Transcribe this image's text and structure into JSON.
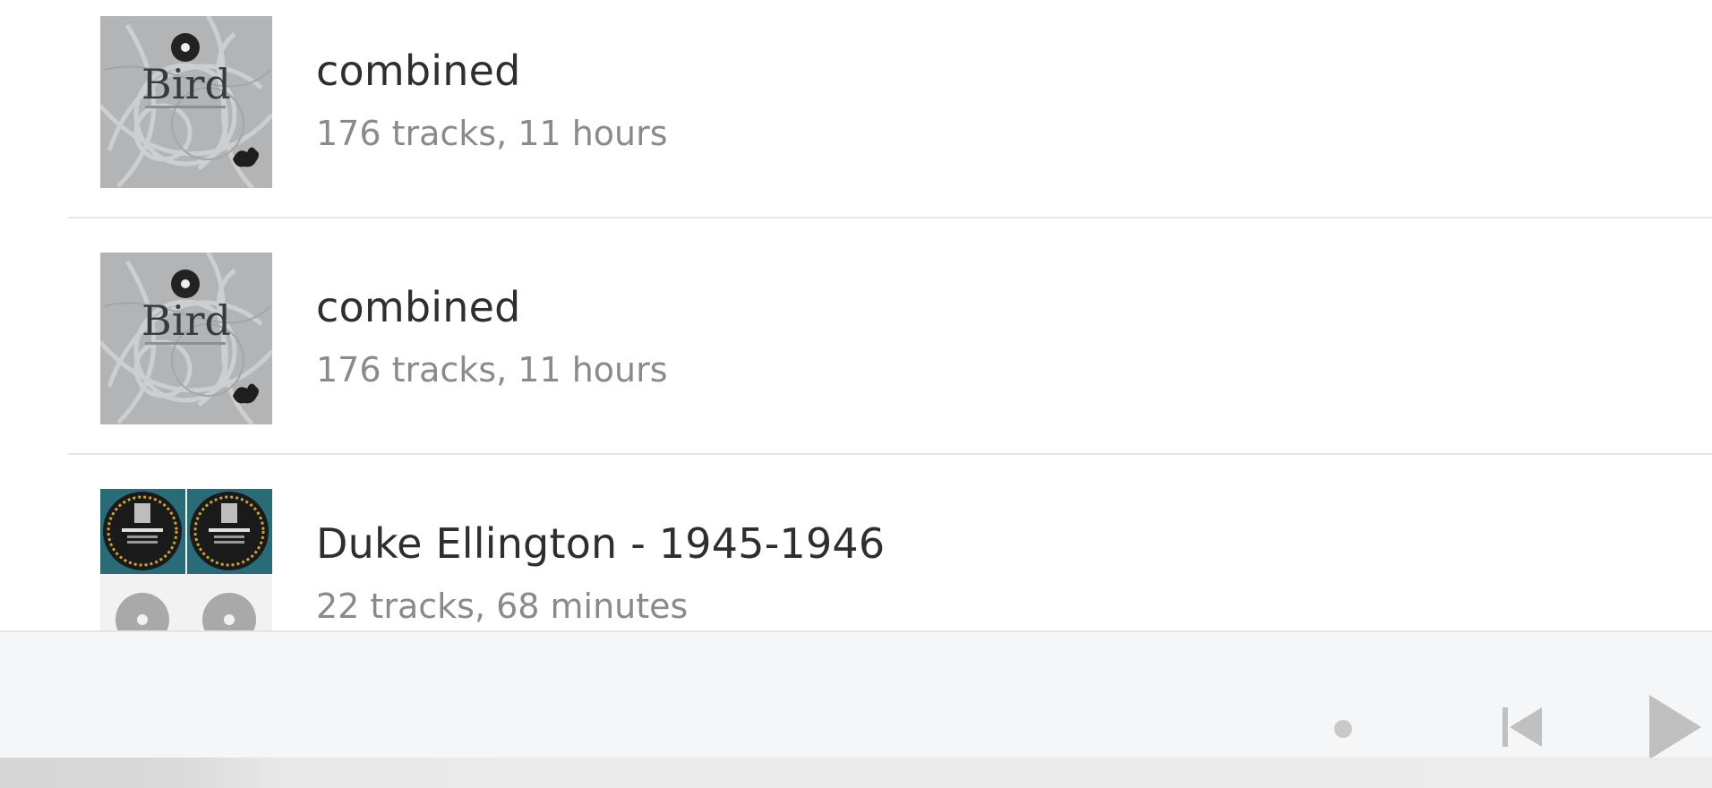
{
  "playlists": [
    {
      "title": "combined",
      "subtitle": "176 tracks, 11 hours",
      "art": "bird-album-cover",
      "art_text": "Bird"
    },
    {
      "title": "combined",
      "subtitle": "176 tracks, 11 hours",
      "art": "bird-album-cover",
      "art_text": "Bird"
    },
    {
      "title": "Duke Ellington - 1945-1946",
      "subtitle": "22 tracks, 68 minutes",
      "art": "collage-album-cover"
    }
  ],
  "player": {
    "indicator_icon": "dot-icon",
    "prev_icon": "skip-previous-icon",
    "play_icon": "play-icon"
  },
  "colors": {
    "background": "#ffffff",
    "title": "#2e2e2e",
    "subtitle": "#8a8a8a",
    "divider": "#e6e6e6",
    "player_bar": "#f5f6f7",
    "controls": "#c0c0c0"
  }
}
